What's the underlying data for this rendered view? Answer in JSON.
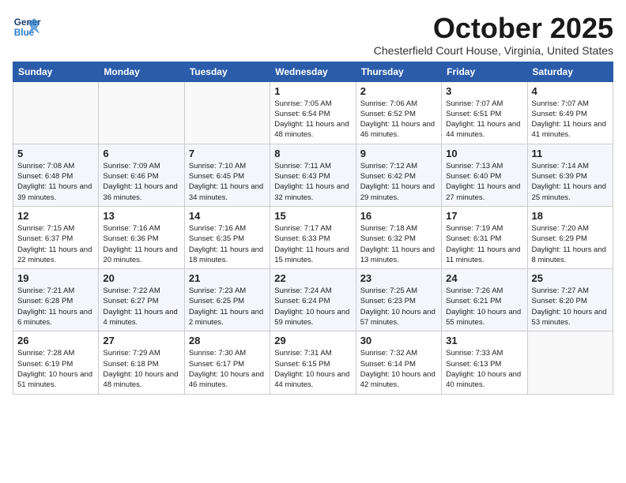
{
  "header": {
    "logo_line1": "General",
    "logo_line2": "Blue",
    "month": "October 2025",
    "location": "Chesterfield Court House, Virginia, United States"
  },
  "weekdays": [
    "Sunday",
    "Monday",
    "Tuesday",
    "Wednesday",
    "Thursday",
    "Friday",
    "Saturday"
  ],
  "weeks": [
    [
      {
        "day": "",
        "info": ""
      },
      {
        "day": "",
        "info": ""
      },
      {
        "day": "",
        "info": ""
      },
      {
        "day": "1",
        "info": "Sunrise: 7:05 AM\nSunset: 6:54 PM\nDaylight: 11 hours\nand 48 minutes."
      },
      {
        "day": "2",
        "info": "Sunrise: 7:06 AM\nSunset: 6:52 PM\nDaylight: 11 hours\nand 46 minutes."
      },
      {
        "day": "3",
        "info": "Sunrise: 7:07 AM\nSunset: 6:51 PM\nDaylight: 11 hours\nand 44 minutes."
      },
      {
        "day": "4",
        "info": "Sunrise: 7:07 AM\nSunset: 6:49 PM\nDaylight: 11 hours\nand 41 minutes."
      }
    ],
    [
      {
        "day": "5",
        "info": "Sunrise: 7:08 AM\nSunset: 6:48 PM\nDaylight: 11 hours\nand 39 minutes."
      },
      {
        "day": "6",
        "info": "Sunrise: 7:09 AM\nSunset: 6:46 PM\nDaylight: 11 hours\nand 36 minutes."
      },
      {
        "day": "7",
        "info": "Sunrise: 7:10 AM\nSunset: 6:45 PM\nDaylight: 11 hours\nand 34 minutes."
      },
      {
        "day": "8",
        "info": "Sunrise: 7:11 AM\nSunset: 6:43 PM\nDaylight: 11 hours\nand 32 minutes."
      },
      {
        "day": "9",
        "info": "Sunrise: 7:12 AM\nSunset: 6:42 PM\nDaylight: 11 hours\nand 29 minutes."
      },
      {
        "day": "10",
        "info": "Sunrise: 7:13 AM\nSunset: 6:40 PM\nDaylight: 11 hours\nand 27 minutes."
      },
      {
        "day": "11",
        "info": "Sunrise: 7:14 AM\nSunset: 6:39 PM\nDaylight: 11 hours\nand 25 minutes."
      }
    ],
    [
      {
        "day": "12",
        "info": "Sunrise: 7:15 AM\nSunset: 6:37 PM\nDaylight: 11 hours\nand 22 minutes."
      },
      {
        "day": "13",
        "info": "Sunrise: 7:16 AM\nSunset: 6:36 PM\nDaylight: 11 hours\nand 20 minutes."
      },
      {
        "day": "14",
        "info": "Sunrise: 7:16 AM\nSunset: 6:35 PM\nDaylight: 11 hours\nand 18 minutes."
      },
      {
        "day": "15",
        "info": "Sunrise: 7:17 AM\nSunset: 6:33 PM\nDaylight: 11 hours\nand 15 minutes."
      },
      {
        "day": "16",
        "info": "Sunrise: 7:18 AM\nSunset: 6:32 PM\nDaylight: 11 hours\nand 13 minutes."
      },
      {
        "day": "17",
        "info": "Sunrise: 7:19 AM\nSunset: 6:31 PM\nDaylight: 11 hours\nand 11 minutes."
      },
      {
        "day": "18",
        "info": "Sunrise: 7:20 AM\nSunset: 6:29 PM\nDaylight: 11 hours\nand 8 minutes."
      }
    ],
    [
      {
        "day": "19",
        "info": "Sunrise: 7:21 AM\nSunset: 6:28 PM\nDaylight: 11 hours\nand 6 minutes."
      },
      {
        "day": "20",
        "info": "Sunrise: 7:22 AM\nSunset: 6:27 PM\nDaylight: 11 hours\nand 4 minutes."
      },
      {
        "day": "21",
        "info": "Sunrise: 7:23 AM\nSunset: 6:25 PM\nDaylight: 11 hours\nand 2 minutes."
      },
      {
        "day": "22",
        "info": "Sunrise: 7:24 AM\nSunset: 6:24 PM\nDaylight: 10 hours\nand 59 minutes."
      },
      {
        "day": "23",
        "info": "Sunrise: 7:25 AM\nSunset: 6:23 PM\nDaylight: 10 hours\nand 57 minutes."
      },
      {
        "day": "24",
        "info": "Sunrise: 7:26 AM\nSunset: 6:21 PM\nDaylight: 10 hours\nand 55 minutes."
      },
      {
        "day": "25",
        "info": "Sunrise: 7:27 AM\nSunset: 6:20 PM\nDaylight: 10 hours\nand 53 minutes."
      }
    ],
    [
      {
        "day": "26",
        "info": "Sunrise: 7:28 AM\nSunset: 6:19 PM\nDaylight: 10 hours\nand 51 minutes."
      },
      {
        "day": "27",
        "info": "Sunrise: 7:29 AM\nSunset: 6:18 PM\nDaylight: 10 hours\nand 48 minutes."
      },
      {
        "day": "28",
        "info": "Sunrise: 7:30 AM\nSunset: 6:17 PM\nDaylight: 10 hours\nand 46 minutes."
      },
      {
        "day": "29",
        "info": "Sunrise: 7:31 AM\nSunset: 6:15 PM\nDaylight: 10 hours\nand 44 minutes."
      },
      {
        "day": "30",
        "info": "Sunrise: 7:32 AM\nSunset: 6:14 PM\nDaylight: 10 hours\nand 42 minutes."
      },
      {
        "day": "31",
        "info": "Sunrise: 7:33 AM\nSunset: 6:13 PM\nDaylight: 10 hours\nand 40 minutes."
      },
      {
        "day": "",
        "info": ""
      }
    ]
  ]
}
